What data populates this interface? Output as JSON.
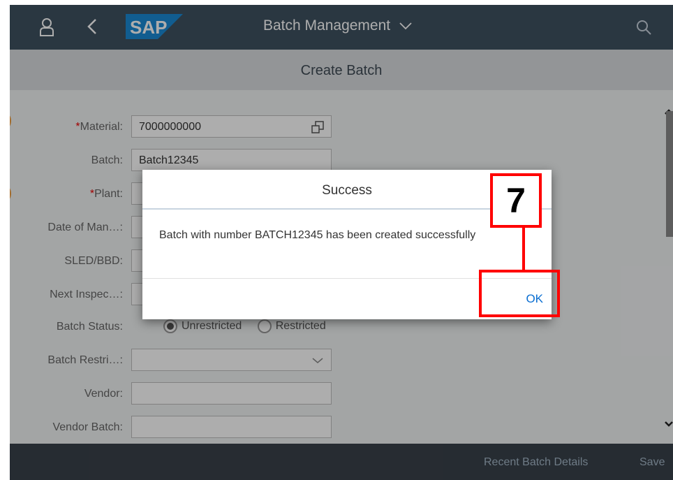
{
  "shell": {
    "logo": "SAP",
    "app_title": "Batch Management"
  },
  "page": {
    "title": "Create Batch"
  },
  "form": {
    "material": {
      "label": "Material:",
      "value": "7000000000"
    },
    "batch": {
      "label": "Batch:",
      "value": "Batch12345"
    },
    "plant": {
      "label": "Plant:",
      "value": ""
    },
    "date_of_manufacture": {
      "label": "Date of Man…:",
      "value": ""
    },
    "sled_bbd": {
      "label": "SLED/BBD:",
      "value": ""
    },
    "next_inspection": {
      "label": "Next Inspec…:",
      "value": ""
    },
    "batch_status": {
      "label": "Batch Status:",
      "options": [
        "Unrestricted",
        "Restricted"
      ],
      "selected": "Unrestricted"
    },
    "batch_restriction": {
      "label": "Batch Restri…:",
      "value": ""
    },
    "vendor": {
      "label": "Vendor:",
      "value": ""
    },
    "vendor_batch": {
      "label": "Vendor Batch:",
      "value": ""
    }
  },
  "footer": {
    "recent_batch_details": "Recent Batch Details",
    "save": "Save"
  },
  "dialog": {
    "title": "Success",
    "message": "Batch with number BATCH12345 has been created successfully",
    "ok": "OK"
  },
  "callout": {
    "step": "7"
  },
  "colors": {
    "shell_bg": "#3f5161",
    "footer_bg": "#39414a",
    "accent": "#0a6ed1",
    "callout": "#ff0000",
    "required": "#ee0000"
  }
}
